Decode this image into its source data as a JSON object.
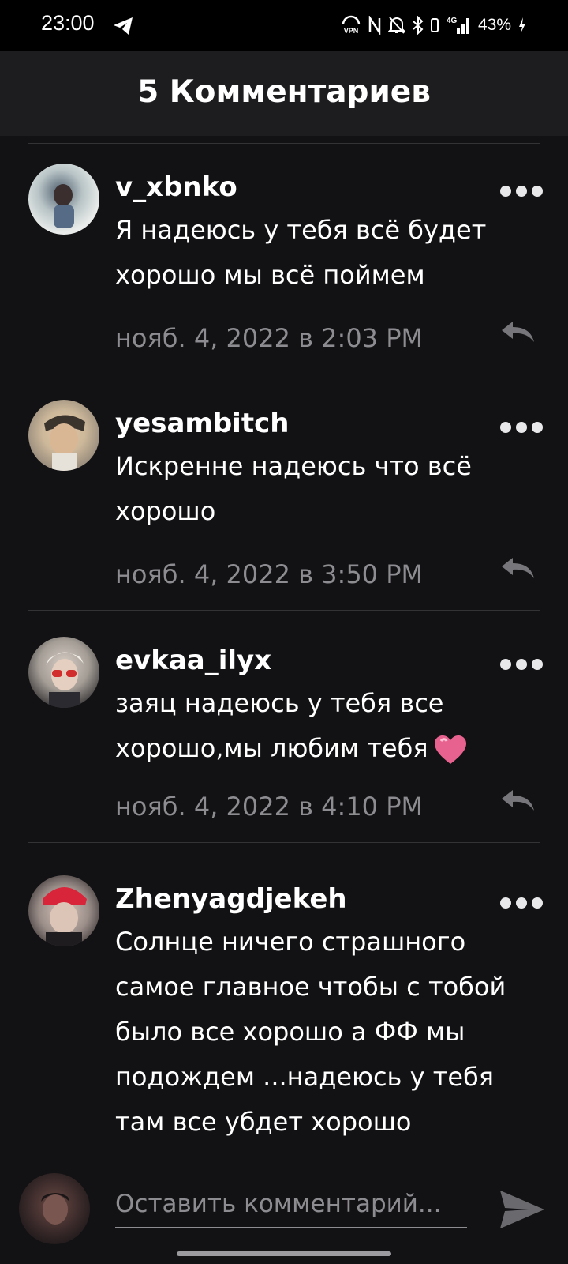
{
  "status_bar": {
    "time": "23:00",
    "battery": "43%",
    "network": "4G",
    "icons": [
      "telegram-icon",
      "vpn-icon",
      "nfc-icon",
      "mute-icon",
      "bluetooth-icon",
      "signal-icon",
      "battery-charging-icon"
    ]
  },
  "header": {
    "title": "5 Комментариев"
  },
  "comments": [
    {
      "username": "v_xbnko",
      "text": "Я надеюсь у тебя всё будет хорошо мы всё поймем",
      "date": "нояб. 4, 2022 в 2:03 PM"
    },
    {
      "username": "yesambitch",
      "text": "Искренне надеюсь что всё хорошо",
      "date": "нояб. 4, 2022 в 3:50 PM"
    },
    {
      "username": "evkaa_ilyx",
      "text": "заяц надеюсь у тебя все хорошо,мы любим тебя",
      "emoji": "heart-icon",
      "date": "нояб. 4, 2022 в 4:10 PM"
    },
    {
      "username": "Zhenyagdjekeh",
      "text": "Солнце ничего страшного самое главное чтобы с тобой было все хорошо а ФФ мы подождем ...надеюсь у тебя там все убдет хорошо"
    }
  ],
  "composer": {
    "placeholder": "Оставить комментарий..."
  },
  "colors": {
    "background": "#121113",
    "header": "#1d1c1e",
    "secondary_text": "#8d8c90",
    "heart": "#e8628f"
  }
}
